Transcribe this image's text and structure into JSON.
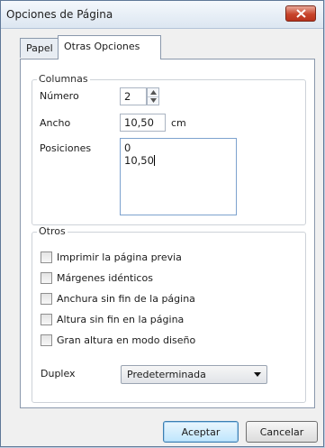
{
  "window": {
    "title": "Opciones de Página"
  },
  "tabs": [
    {
      "label": "Papel",
      "active": false
    },
    {
      "label": "Otras Opciones",
      "active": true
    }
  ],
  "columnas": {
    "legend": "Columnas",
    "numero_label": "Número",
    "numero_value": "2",
    "ancho_label": "Ancho",
    "ancho_value": "10,50",
    "ancho_unit": "cm",
    "posiciones_label": "Posiciones",
    "posiciones_values": [
      "0",
      "10,50"
    ]
  },
  "otros": {
    "legend": "Otros",
    "checkboxes": [
      {
        "label": "Imprimir la página previa",
        "checked": false
      },
      {
        "label": "Márgenes idénticos",
        "checked": false
      },
      {
        "label": "Anchura sin fin de la página",
        "checked": false
      },
      {
        "label": "Altura sin fin en la página",
        "checked": false
      },
      {
        "label": "Gran altura en modo diseño",
        "checked": false
      }
    ],
    "duplex_label": "Duplex",
    "duplex_value": "Predeterminada"
  },
  "buttons": {
    "ok": "Aceptar",
    "cancel": "Cancelar"
  },
  "colors": {
    "title_bar": "#dce6f1",
    "close_button": "#c8452c",
    "default_button": "#bee6fd"
  }
}
